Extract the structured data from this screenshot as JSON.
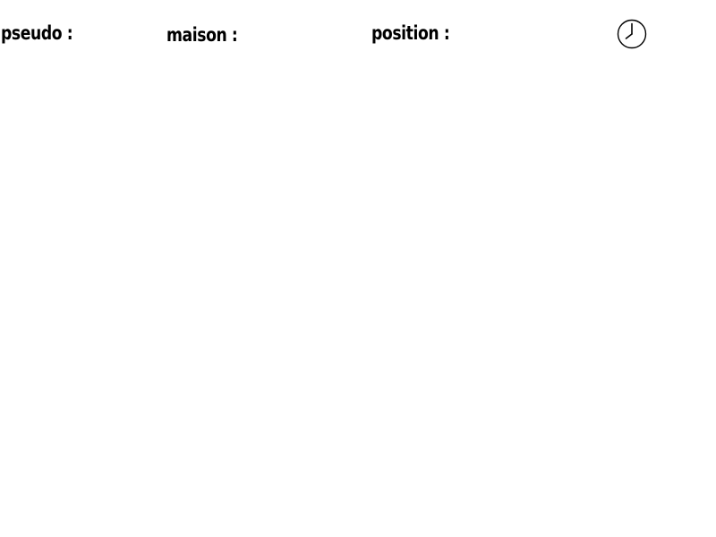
{
  "hud": {
    "pseudo_label": "pseudo :",
    "maison_label": "maison :",
    "position_label": "position :",
    "clock_icon": "clock-icon"
  },
  "colors": {
    "background": "#ffffff",
    "text": "#000000"
  }
}
